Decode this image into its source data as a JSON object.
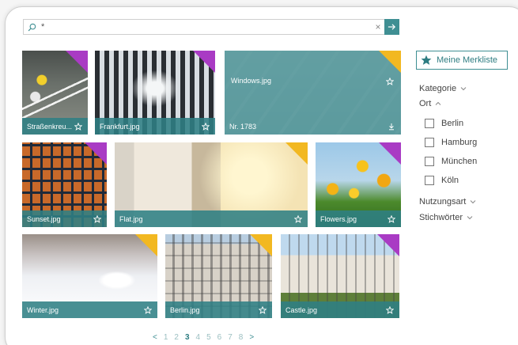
{
  "search": {
    "value": "*",
    "clear_glyph": "×",
    "icon": "search-icon",
    "go_icon": "arrow-right-icon"
  },
  "tiles": [
    {
      "name": "Straßenkreu...",
      "corner": "#a93bc4"
    },
    {
      "name": "Frankfurt.jpg",
      "corner": "#a93bc4"
    },
    {
      "name": "Windows.jpg",
      "corner": "#f2b821",
      "sub": "Nr. 1783"
    },
    {
      "name": "Sunset.jpg",
      "corner": "#a93bc4"
    },
    {
      "name": "Flat.jpg",
      "corner": "#f2b821"
    },
    {
      "name": "Flowers.jpg",
      "corner": "#a93bc4"
    },
    {
      "name": "Winter.jpg",
      "corner": "#f2b821"
    },
    {
      "name": "Berlin.jpg",
      "corner": "#f2b821"
    },
    {
      "name": "Castle.jpg",
      "corner": "#a93bc4"
    }
  ],
  "sidebar": {
    "merkliste": "Meine Merkliste",
    "filters": {
      "kategorie": "Kategorie",
      "ort": "Ort",
      "nutzungsart": "Nutzungsart",
      "stichwoerter": "Stichwörter"
    },
    "ort_options": [
      "Berlin",
      "Hamburg",
      "München",
      "Köln"
    ]
  },
  "pagination": {
    "prev": "<",
    "pages": [
      "1",
      "2",
      "3",
      "4",
      "5",
      "6",
      "7",
      "8"
    ],
    "current": "3",
    "next": ">"
  },
  "colors": {
    "accent": "#3f8f93",
    "purple": "#a93bc4",
    "yellow": "#f2b821"
  }
}
